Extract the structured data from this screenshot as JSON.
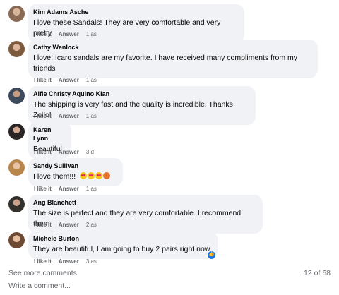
{
  "comments": [
    {
      "name": "Kim Adams Asche",
      "text": "I love these Sandals! They are very comfortable and very pretty",
      "like": "I like it",
      "answer": "Answer",
      "time": "1 as"
    },
    {
      "name": "Cathy Wenlock",
      "text": "I love! Icaro sandals are my favorite. I have received many compliments from my friends",
      "like": "I like it",
      "answer": "Answer",
      "time": "1 as"
    },
    {
      "name": "Alfie Christy Aquino Klan",
      "text": "The shipping is very fast and the quality is incredible. Thanks Zoilo!",
      "like": "I like it",
      "answer": "Answer",
      "time": "1 as"
    },
    {
      "name": "Karen Lynn",
      "text": "Beautiful",
      "like": "I like it",
      "answer": "Answer",
      "time": "3 d"
    },
    {
      "name": "Sandy Sullivan",
      "text": "I love them!!!",
      "like": "I like it",
      "answer": "Answer",
      "time": "1 as"
    },
    {
      "name": "Ang Blanchett",
      "text": "The size is perfect and they are very comfortable. I recommend them",
      "like": "I like it",
      "answer": "Answer",
      "time": "2 as"
    },
    {
      "name": "Michele Burton",
      "text": "They are beautiful, I am going to buy 2 pairs right now",
      "like": "I like it",
      "answer": "Answer",
      "time": "3 as"
    }
  ],
  "footer": {
    "see_more": "See more comments",
    "count": "12 of 68",
    "write_placeholder": "Write a comment..."
  },
  "colors": {
    "bubble": "#f0f2f5",
    "meta_text": "#65676b",
    "like_blue": "#1877f2"
  }
}
